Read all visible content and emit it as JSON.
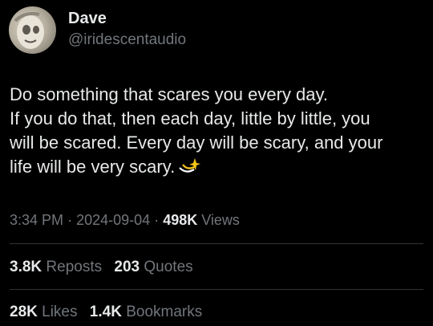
{
  "author": {
    "display_name": "Dave",
    "handle": "@iridescentaudio",
    "avatar": "avatar-image"
  },
  "body": {
    "lines": [
      "Do something that scares you every day.",
      "If you do that, then each day, little by little, you",
      "will be scared. Every day will be scary, and your",
      "life will be very scary."
    ],
    "emoji": "dizzy-sparkle-icon"
  },
  "meta": {
    "time": "3:34 PM",
    "separator": "·",
    "date": "2024-09-04",
    "views_count": "498K",
    "views_label": "Views"
  },
  "stats": {
    "reposts_count": "3.8K",
    "reposts_label": "Reposts",
    "quotes_count": "203",
    "quotes_label": "Quotes",
    "likes_count": "28K",
    "likes_label": "Likes",
    "bookmarks_count": "1.4K",
    "bookmarks_label": "Bookmarks"
  },
  "colors": {
    "background": "#000000",
    "primary_text": "#e7e9ea",
    "secondary_text": "#71767b",
    "divider": "#2f3336",
    "emoji_yellow": "#f5c518"
  }
}
